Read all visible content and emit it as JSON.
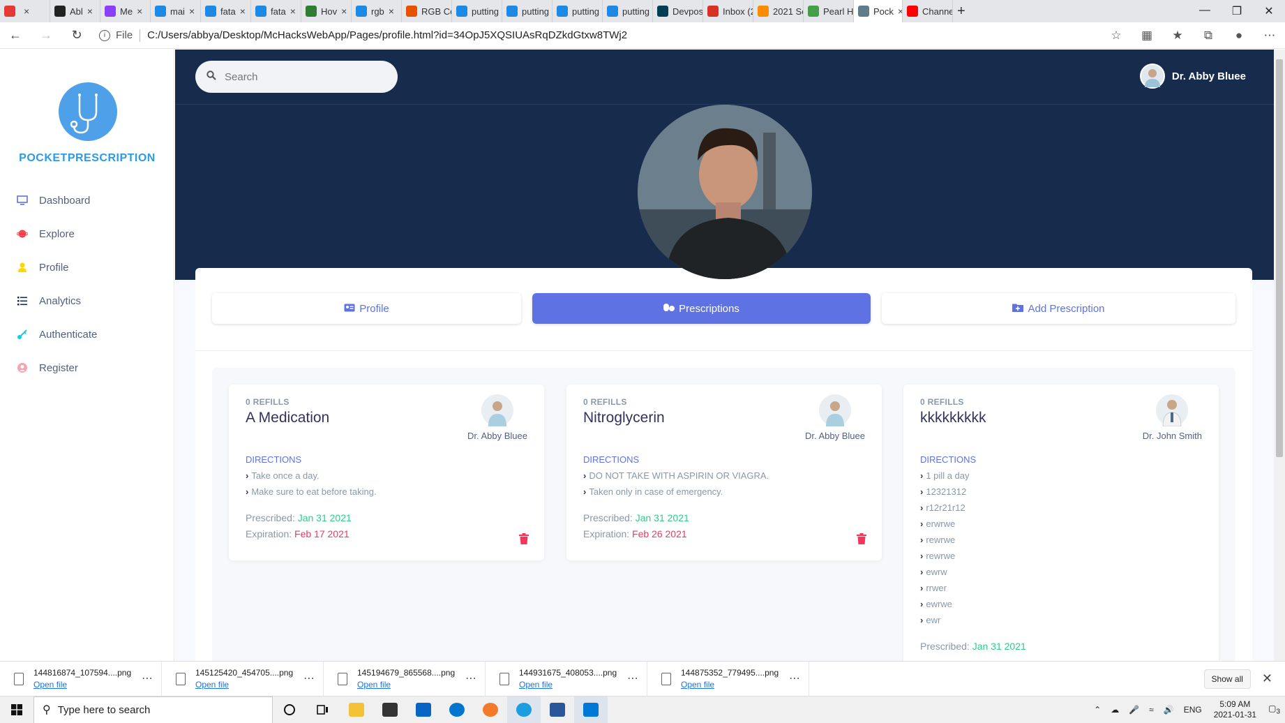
{
  "browser": {
    "tabs": [
      {
        "label": "",
        "color": "#e53935"
      },
      {
        "label": "Abl",
        "color": "#222222"
      },
      {
        "label": "Me",
        "color": "#8a3ffc"
      },
      {
        "label": "mai",
        "color": "#1e88e5"
      },
      {
        "label": "fata",
        "color": "#1e88e5"
      },
      {
        "label": "fata",
        "color": "#1e88e5"
      },
      {
        "label": "Hov",
        "color": "#2e7d32"
      },
      {
        "label": "rgb",
        "color": "#1e88e5"
      },
      {
        "label": "RGB Colo",
        "color": "#e65100"
      },
      {
        "label": "putting a",
        "color": "#1e88e5"
      },
      {
        "label": "putting a",
        "color": "#1e88e5"
      },
      {
        "label": "putting a",
        "color": "#1e88e5"
      },
      {
        "label": "putting a",
        "color": "#1e88e5"
      },
      {
        "label": "Devpost",
        "color": "#003e54"
      },
      {
        "label": "Inbox (2",
        "color": "#d93025"
      },
      {
        "label": "2021 Sea",
        "color": "#fb8c00"
      },
      {
        "label": "Pearl Ha",
        "color": "#43a047"
      },
      {
        "label": "Pock",
        "color": "#607d8b",
        "active": true
      },
      {
        "label": "Channel",
        "color": "#ff0000"
      }
    ],
    "address": {
      "file_label": "File",
      "url": "C:/Users/abbya/Desktop/McHacksWebApp/Pages/profile.html?id=34OpJ5XQSIUAsRqDZkdGtxw8TWj2"
    }
  },
  "sidebar": {
    "brand": "POCKETPRESCRIPTION",
    "items": [
      {
        "label": "Dashboard",
        "icon": "monitor-icon",
        "color": "#5e72e4"
      },
      {
        "label": "Explore",
        "icon": "planet-icon",
        "color": "#f5365c"
      },
      {
        "label": "Profile",
        "icon": "user-icon",
        "color": "#ffd600"
      },
      {
        "label": "Analytics",
        "icon": "list-icon",
        "color": "#172b4d"
      },
      {
        "label": "Authenticate",
        "icon": "key-icon",
        "color": "#11cdef"
      },
      {
        "label": "Register",
        "icon": "circle-user-icon",
        "color": "#f3a4b5"
      }
    ]
  },
  "header": {
    "search_placeholder": "Search",
    "user_name": "Dr. Abby Bluee"
  },
  "tabs": {
    "profile": "Profile",
    "prescriptions": "Prescriptions",
    "add": "Add Prescription"
  },
  "prescriptions": [
    {
      "refills": "0 REFILLS",
      "name": "A Medication",
      "doctor": "Dr. Abby Bluee",
      "directions_title": "DIRECTIONS",
      "directions": [
        "Take once a day.",
        "Make sure to eat before taking."
      ],
      "prescribed_label": "Prescribed:",
      "prescribed": "Jan 31 2021",
      "expiration_label": "Expiration:",
      "expiration": "Feb 17 2021"
    },
    {
      "refills": "0 REFILLS",
      "name": "Nitroglycerin",
      "doctor": "Dr. Abby Bluee",
      "directions_title": "DIRECTIONS",
      "directions": [
        "DO NOT TAKE WITH ASPIRIN OR VIAGRA.",
        "Taken only in case of emergency."
      ],
      "prescribed_label": "Prescribed:",
      "prescribed": "Jan 31 2021",
      "expiration_label": "Expiration:",
      "expiration": "Feb 26 2021"
    },
    {
      "refills": "0 REFILLS",
      "name": "kkkkkkkkk",
      "doctor": "Dr. John Smith",
      "directions_title": "DIRECTIONS",
      "directions": [
        "1 pill a day",
        "12321312",
        "r12r21r12",
        "erwrwe",
        "rewrwe",
        "rewrwe",
        "ewrw",
        "rrwer",
        "ewrwe",
        "ewr"
      ],
      "prescribed_label": "Prescribed:",
      "prescribed": "Jan 31 2021"
    }
  ],
  "downloads": {
    "items": [
      {
        "name": "144816874_107594....png",
        "action": "Open file"
      },
      {
        "name": "145125420_454705....png",
        "action": "Open file"
      },
      {
        "name": "145194679_865568....png",
        "action": "Open file"
      },
      {
        "name": "144931675_408053....png",
        "action": "Open file"
      },
      {
        "name": "144875352_779495....png",
        "action": "Open file"
      }
    ],
    "show_all": "Show all"
  },
  "taskbar": {
    "search_placeholder": "Type here to search",
    "lang": "ENG",
    "time": "5:09 AM",
    "date": "2021-01-31",
    "notifications": "3"
  }
}
